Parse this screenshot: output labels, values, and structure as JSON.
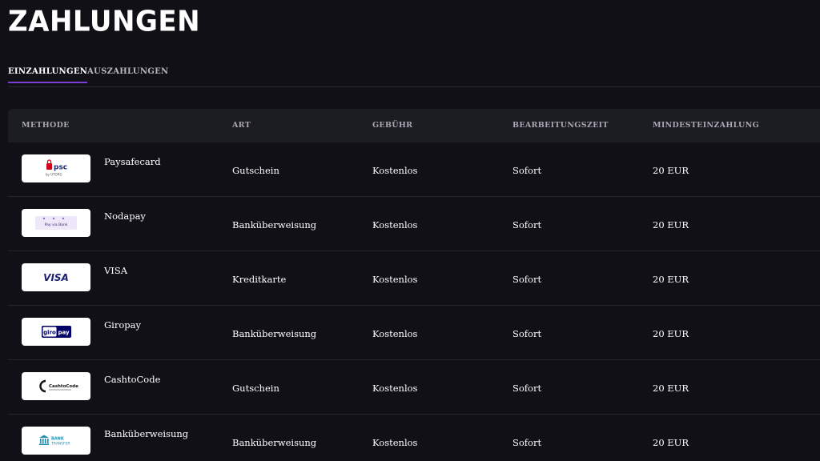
{
  "page": {
    "title": "ZAHLUNGEN"
  },
  "tabs": [
    {
      "label": "EINZAHLUNGEN",
      "active": true
    },
    {
      "label": "AUSZAHLUNGEN",
      "active": false
    }
  ],
  "table": {
    "headers": [
      "METHODE",
      "ART",
      "GEBÜHR",
      "BEARBEITUNGSZEIT",
      "MINDESTEINZAHLUNG"
    ],
    "rows": [
      {
        "method": "Paysafecard",
        "logo": "paysafecard-logo",
        "logo_text": "psc",
        "logo_sub": "by UTORG",
        "type": "Gutschein",
        "fee": "Kostenlos",
        "time": "Sofort",
        "min": "20 EUR"
      },
      {
        "method": "Nodapay",
        "logo": "nodapay-logo",
        "logo_text": "Pay via Bank",
        "logo_sub": "",
        "type": "Banküberweisung",
        "fee": "Kostenlos",
        "time": "Sofort",
        "min": "20 EUR"
      },
      {
        "method": "VISA",
        "logo": "visa-logo",
        "logo_text": "VISA",
        "logo_sub": "",
        "type": "Kreditkarte",
        "fee": "Kostenlos",
        "time": "Sofort",
        "min": "20 EUR"
      },
      {
        "method": "Giropay",
        "logo": "giropay-logo",
        "logo_text": "giro",
        "logo_sub": "pay",
        "type": "Banküberweisung",
        "fee": "Kostenlos",
        "time": "Sofort",
        "min": "20 EUR"
      },
      {
        "method": "CashtoCode",
        "logo": "cashtocode-logo",
        "logo_text": "CashtoCode",
        "logo_sub": "",
        "type": "Gutschein",
        "fee": "Kostenlos",
        "time": "Sofort",
        "min": "20 EUR"
      },
      {
        "method": "Banküberweisung",
        "logo": "bank-transfer-logo",
        "logo_text": "BANK",
        "logo_sub": "TRANSFER",
        "type": "Banküberweisung",
        "fee": "Kostenlos",
        "time": "Sofort",
        "min": "20 EUR"
      }
    ]
  },
  "colors": {
    "background": "#111016",
    "header_bg": "#1c1c23",
    "tab_accent": "#7b3fd6",
    "visa_blue": "#1a1f71",
    "paysafe_red": "#d0021b",
    "giropay_navy": "#000268",
    "giropay_red": "#ff0007",
    "bank_teal": "#1f8fb4"
  }
}
